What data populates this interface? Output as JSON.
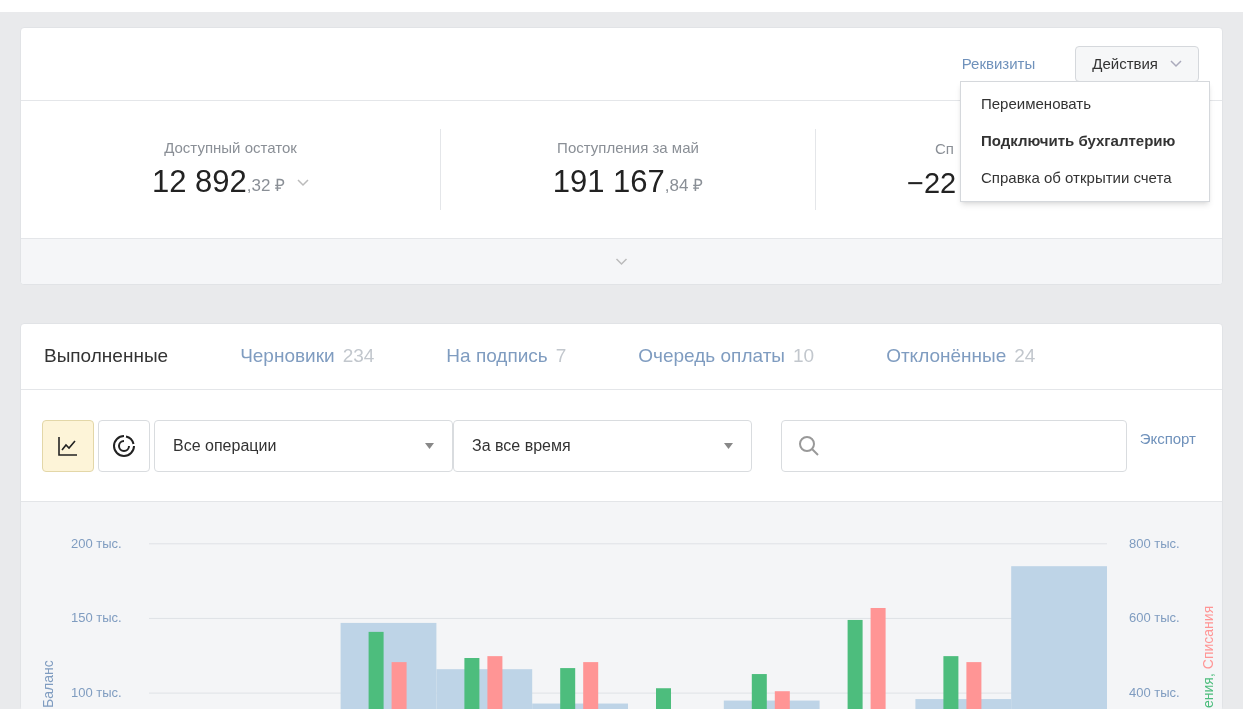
{
  "header": {
    "link": "Реквизиты",
    "actions_button": "Действия",
    "menu": [
      {
        "label": "Переименовать",
        "selected": false
      },
      {
        "label": "Подключить бухгалтерию",
        "selected": true
      },
      {
        "label": "Справка об открытии счета",
        "selected": false
      }
    ]
  },
  "stats": [
    {
      "label": "Доступный остаток",
      "whole": "12 892",
      "fraction": ",32 ₽",
      "has_dropdown": true
    },
    {
      "label": "Поступления за май",
      "whole": "191 167",
      "fraction": ",84 ₽"
    },
    {
      "label": "Сп",
      "whole": "−22"
    }
  ],
  "tabs": [
    {
      "label": "Выполненные",
      "selected": true
    },
    {
      "label": "Черновики",
      "count": "234",
      "selected": false
    },
    {
      "label": "На подпись",
      "count": "7",
      "selected": false
    },
    {
      "label": "Очередь оплаты",
      "count": "10",
      "selected": false
    },
    {
      "label": "Отклонённые",
      "count": "24",
      "selected": false
    }
  ],
  "toolbar": {
    "view_buttons": [
      {
        "kind": "line",
        "selected": true
      },
      {
        "kind": "pie",
        "selected": false
      }
    ],
    "filters": [
      {
        "value": "Все операции"
      },
      {
        "value": "За все время"
      }
    ],
    "export": "Экспорт"
  },
  "chart": {
    "chart_data": {
      "type": "bar",
      "ylabel": "Баланс",
      "grid": true,
      "ylim": [
        88,
        228
      ],
      "y2lim": [
        352,
        912
      ],
      "yticks": [
        {
          "value": 100,
          "label": "100 тыс."
        },
        {
          "value": 150,
          "label": "150 тыс."
        },
        {
          "value": 200,
          "label": "200 тыс."
        }
      ],
      "y2ticks": [
        {
          "value": 400,
          "label": "400 тыс."
        },
        {
          "value": 600,
          "label": "600 тыс."
        },
        {
          "value": 800,
          "label": "800 тыс."
        }
      ],
      "series": [
        {
          "color": "#bed4e7",
          "values": [
            null,
            null,
            147,
            116,
            93,
            null,
            95,
            null,
            96,
            185
          ]
        },
        {
          "name": "ения,",
          "color": "#4dbd7d",
          "axis": "y2",
          "values": [
            null,
            null,
            564,
            494,
            467,
            413,
            451,
            596,
            499,
            null
          ]
        },
        {
          "name": "Списания",
          "color": "#ff9595",
          "axis": "y2",
          "values": [
            null,
            null,
            483,
            499,
            483,
            null,
            405,
            628,
            483,
            null
          ]
        }
      ]
    }
  }
}
